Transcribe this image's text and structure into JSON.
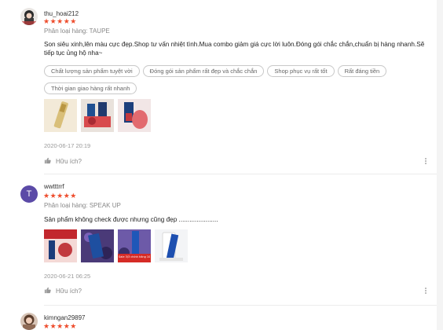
{
  "reviews": [
    {
      "username": "thu_hoai212",
      "stars": "★★★★★",
      "variation": "Phân loại hàng: TAUPE",
      "content": "Son siêu xinh,lên màu cực đẹp.Shop tư vấn nhiệt tình.Mua combo giảm giá cực lời luôn.Đóng gói chắc chắn,chuẩn bị hàng nhanh.Sẽ tiếp tục ủng hộ nha~",
      "tags": [
        "Chất lượng sản phẩm tuyệt vời",
        "Đóng gói sản phẩm rất đẹp và chắc chắn",
        "Shop phục vụ rất tốt",
        "Rất đáng tiền",
        "Thời gian giao hàng rất nhanh"
      ],
      "timestamp": "2020-06-17 20:19",
      "like_label": "Hữu ích?"
    },
    {
      "username": "wwtttrrf",
      "avatar_letter": "T",
      "avatar_color": "#5b4aa7",
      "stars": "★★★★★",
      "variation": "Phân loại hàng: SPEAK UP",
      "content": "Sản phẩm không check được nhưng cũng đẹp ......................",
      "image_caption": "Sale 3/3 chính hãng 100%",
      "timestamp": "2020-06-21 06:25",
      "like_label": "Hữu ích?"
    },
    {
      "username": "kimngan29897",
      "stars": "★★★★★"
    }
  ],
  "colors": {
    "star": "#ee4d2d",
    "avatar2": "#5b4aa7"
  }
}
